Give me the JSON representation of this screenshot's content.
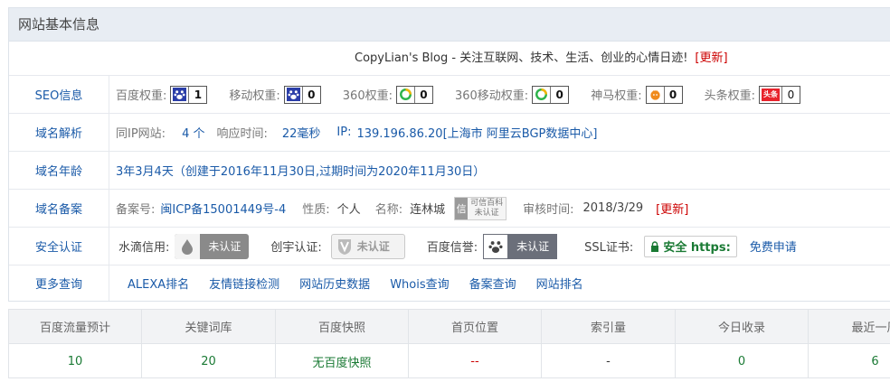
{
  "panel_title": "网站基本信息",
  "site": {
    "line": "CopyLian's Blog - 关注互联网、技术、生活、创业的心情日迹!",
    "update": "[更新]"
  },
  "seo": {
    "label": "SEO信息",
    "items": [
      {
        "name": "百度权重:",
        "icon": "baidu-paw-icon",
        "value": "1"
      },
      {
        "name": "移动权重:",
        "icon": "baidu-paw-icon",
        "value": "0"
      },
      {
        "name": "360权重:",
        "icon": "360-ring-icon",
        "value": "0"
      },
      {
        "name": "360移动权重:",
        "icon": "360-ring-icon",
        "value": "0"
      },
      {
        "name": "神马权重:",
        "icon": "shenma-horse-icon",
        "value": "0"
      },
      {
        "name": "头条权重:",
        "icon": "toutiao-icon",
        "icon_text": "头条",
        "value": "0"
      }
    ]
  },
  "dns": {
    "label": "域名解析",
    "same_ip_label": "同IP网站:",
    "same_ip_value": "4 个",
    "response_label": "响应时间:",
    "response_value": "22毫秒",
    "ip_label": "IP:",
    "ip_value": "139.196.86.20[上海市 阿里云BGP数据中心]"
  },
  "age": {
    "label": "域名年龄",
    "text": "3年3月4天（创建于2016年11月30日,过期时间为2020年11月30日）"
  },
  "icp": {
    "label": "域名备案",
    "no_label": "备案号:",
    "no_value": "闽ICP备15001449号-4",
    "nature_label": "性质:",
    "nature_value": "个人",
    "name_label": "名称:",
    "name_value": "连林城",
    "badge_char": "信",
    "badge_line1": "可信百科",
    "badge_line2": "未认证",
    "time_label": "审核时间:",
    "time_value": "2018/3/29",
    "update": "[更新]"
  },
  "security": {
    "label": "安全认证",
    "shuidi_label": "水滴信用:",
    "shuidi_badge": "未认证",
    "chuangzi_label": "创宇认证:",
    "chuangzi_badge": "未认证",
    "baidu_label": "百度信誉:",
    "baidu_badge": "未认证",
    "ssl_label": "SSL证书:",
    "ssl_badge": "安全 https:",
    "free_apply": "免费申请"
  },
  "more": {
    "label": "更多查询",
    "links": [
      "ALEXA排名",
      "友情链接检测",
      "网站历史数据",
      "Whois查询",
      "备案查询",
      "网站排名"
    ]
  },
  "stats": {
    "headers": [
      "百度流量预计",
      "关键词库",
      "百度快照",
      "首页位置",
      "索引量",
      "今日收录",
      "最近一周"
    ],
    "values": [
      "10",
      "20",
      "无百度快照",
      "--",
      "-",
      "0",
      "6"
    ]
  },
  "colors": {
    "link": "#1a5aa8",
    "green": "#1a7a34",
    "red": "#cc0000",
    "header_bg": "#e8edf3"
  }
}
